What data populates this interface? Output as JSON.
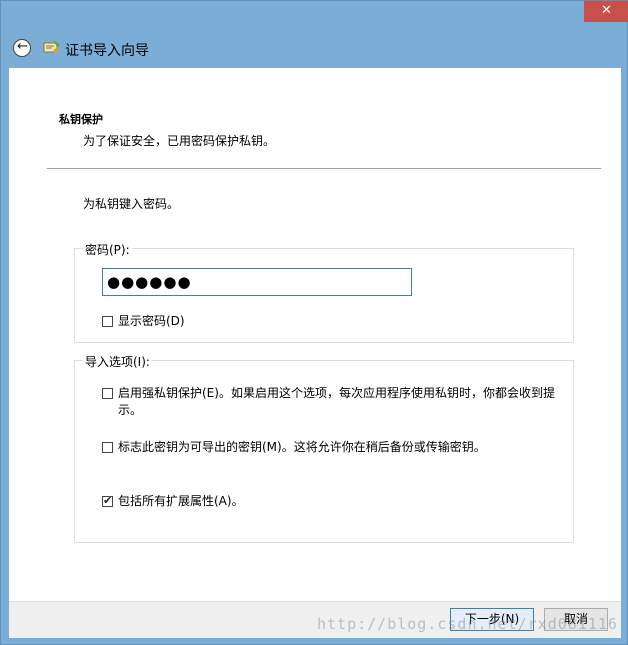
{
  "window": {
    "title": "证书导入向导",
    "close_glyph": "✕"
  },
  "header": {
    "section_heading": "私钥保护",
    "section_desc": "为了保证安全，已用密码保护私钥。"
  },
  "main": {
    "instruction": "为私钥键入密码。",
    "password_group": {
      "label": "密码(P):",
      "value": "●●●●●●",
      "show_password_label": "显示密码(D)",
      "show_password_checked": false
    },
    "options_group": {
      "label": "导入选项(I):",
      "options": [
        {
          "label": "启用强私钥保护(E)。如果启用这个选项，每次应用程序使用私钥时，你都会收到提示。",
          "checked": false
        },
        {
          "label": "标志此密钥为可导出的密钥(M)。这将允许你在稍后备份或传输密钥。",
          "checked": false
        },
        {
          "label": "包括所有扩展属性(A)。",
          "checked": true
        }
      ]
    }
  },
  "footer": {
    "next_label": "下一步(N)",
    "cancel_label": "取消"
  },
  "watermark": "http://blog.csdn.net/rxd081116"
}
